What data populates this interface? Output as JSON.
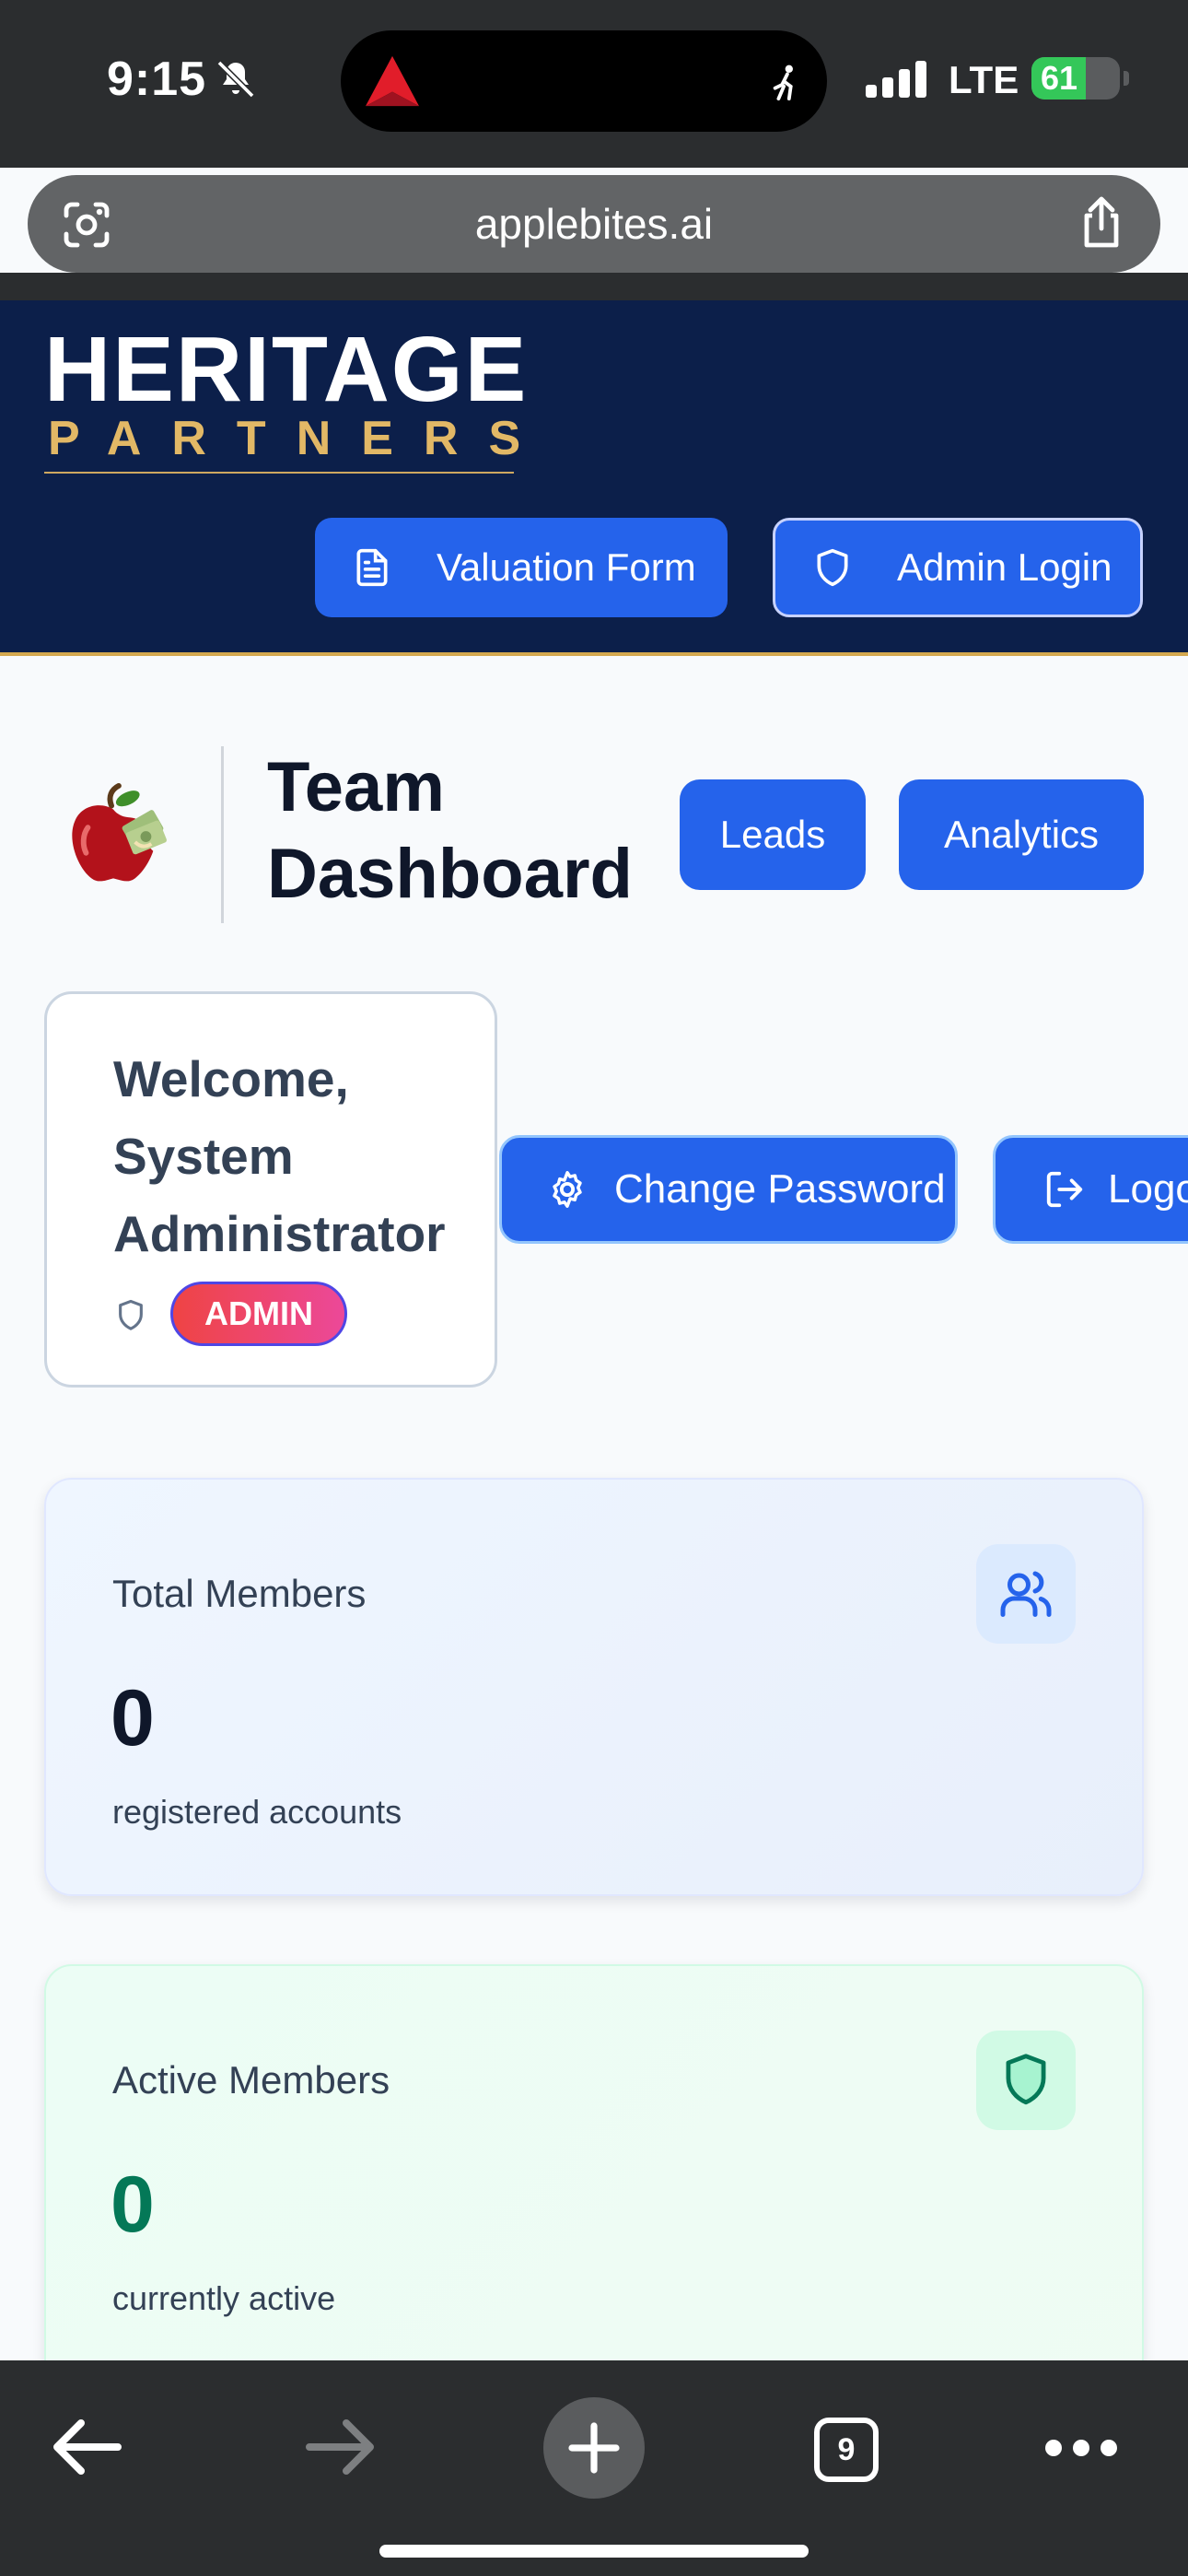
{
  "status_bar": {
    "time": "9:15",
    "network": "LTE",
    "battery": "61",
    "battery_level": 0.61,
    "icons": [
      "bell-slash-icon",
      "delta-app-icon",
      "walking-icon",
      "signal-icon",
      "battery-icon"
    ]
  },
  "browser": {
    "url": "applebites.ai",
    "tab_count": "9",
    "icons": [
      "lens-icon",
      "share-icon",
      "back-icon",
      "forward-icon",
      "new-tab-icon",
      "tabs-icon",
      "more-icon"
    ]
  },
  "header": {
    "logo_line1": "HERITAGE",
    "logo_line2": "PARTNERS",
    "valuation_label": "Valuation Form",
    "admin_login_label": "Admin Login"
  },
  "dashboard": {
    "title": "Team Dashboard",
    "leads_label": "Leads",
    "analytics_label": "Analytics"
  },
  "welcome": {
    "text": "Welcome, System Administrator",
    "role": "ADMIN"
  },
  "actions": {
    "change_password": "Change Password",
    "logout": "Logo"
  },
  "stats": {
    "total_members": {
      "label": "Total Members",
      "value": "0",
      "sub": "registered accounts"
    },
    "active_members": {
      "label": "Active Members",
      "value": "0",
      "sub": "currently active"
    }
  },
  "colors": {
    "primary": "#2563eb",
    "header_bg": "#0c1f4a",
    "gold": "#e2b866",
    "admin_badge": "#ef4444",
    "active_green": "#047857"
  }
}
